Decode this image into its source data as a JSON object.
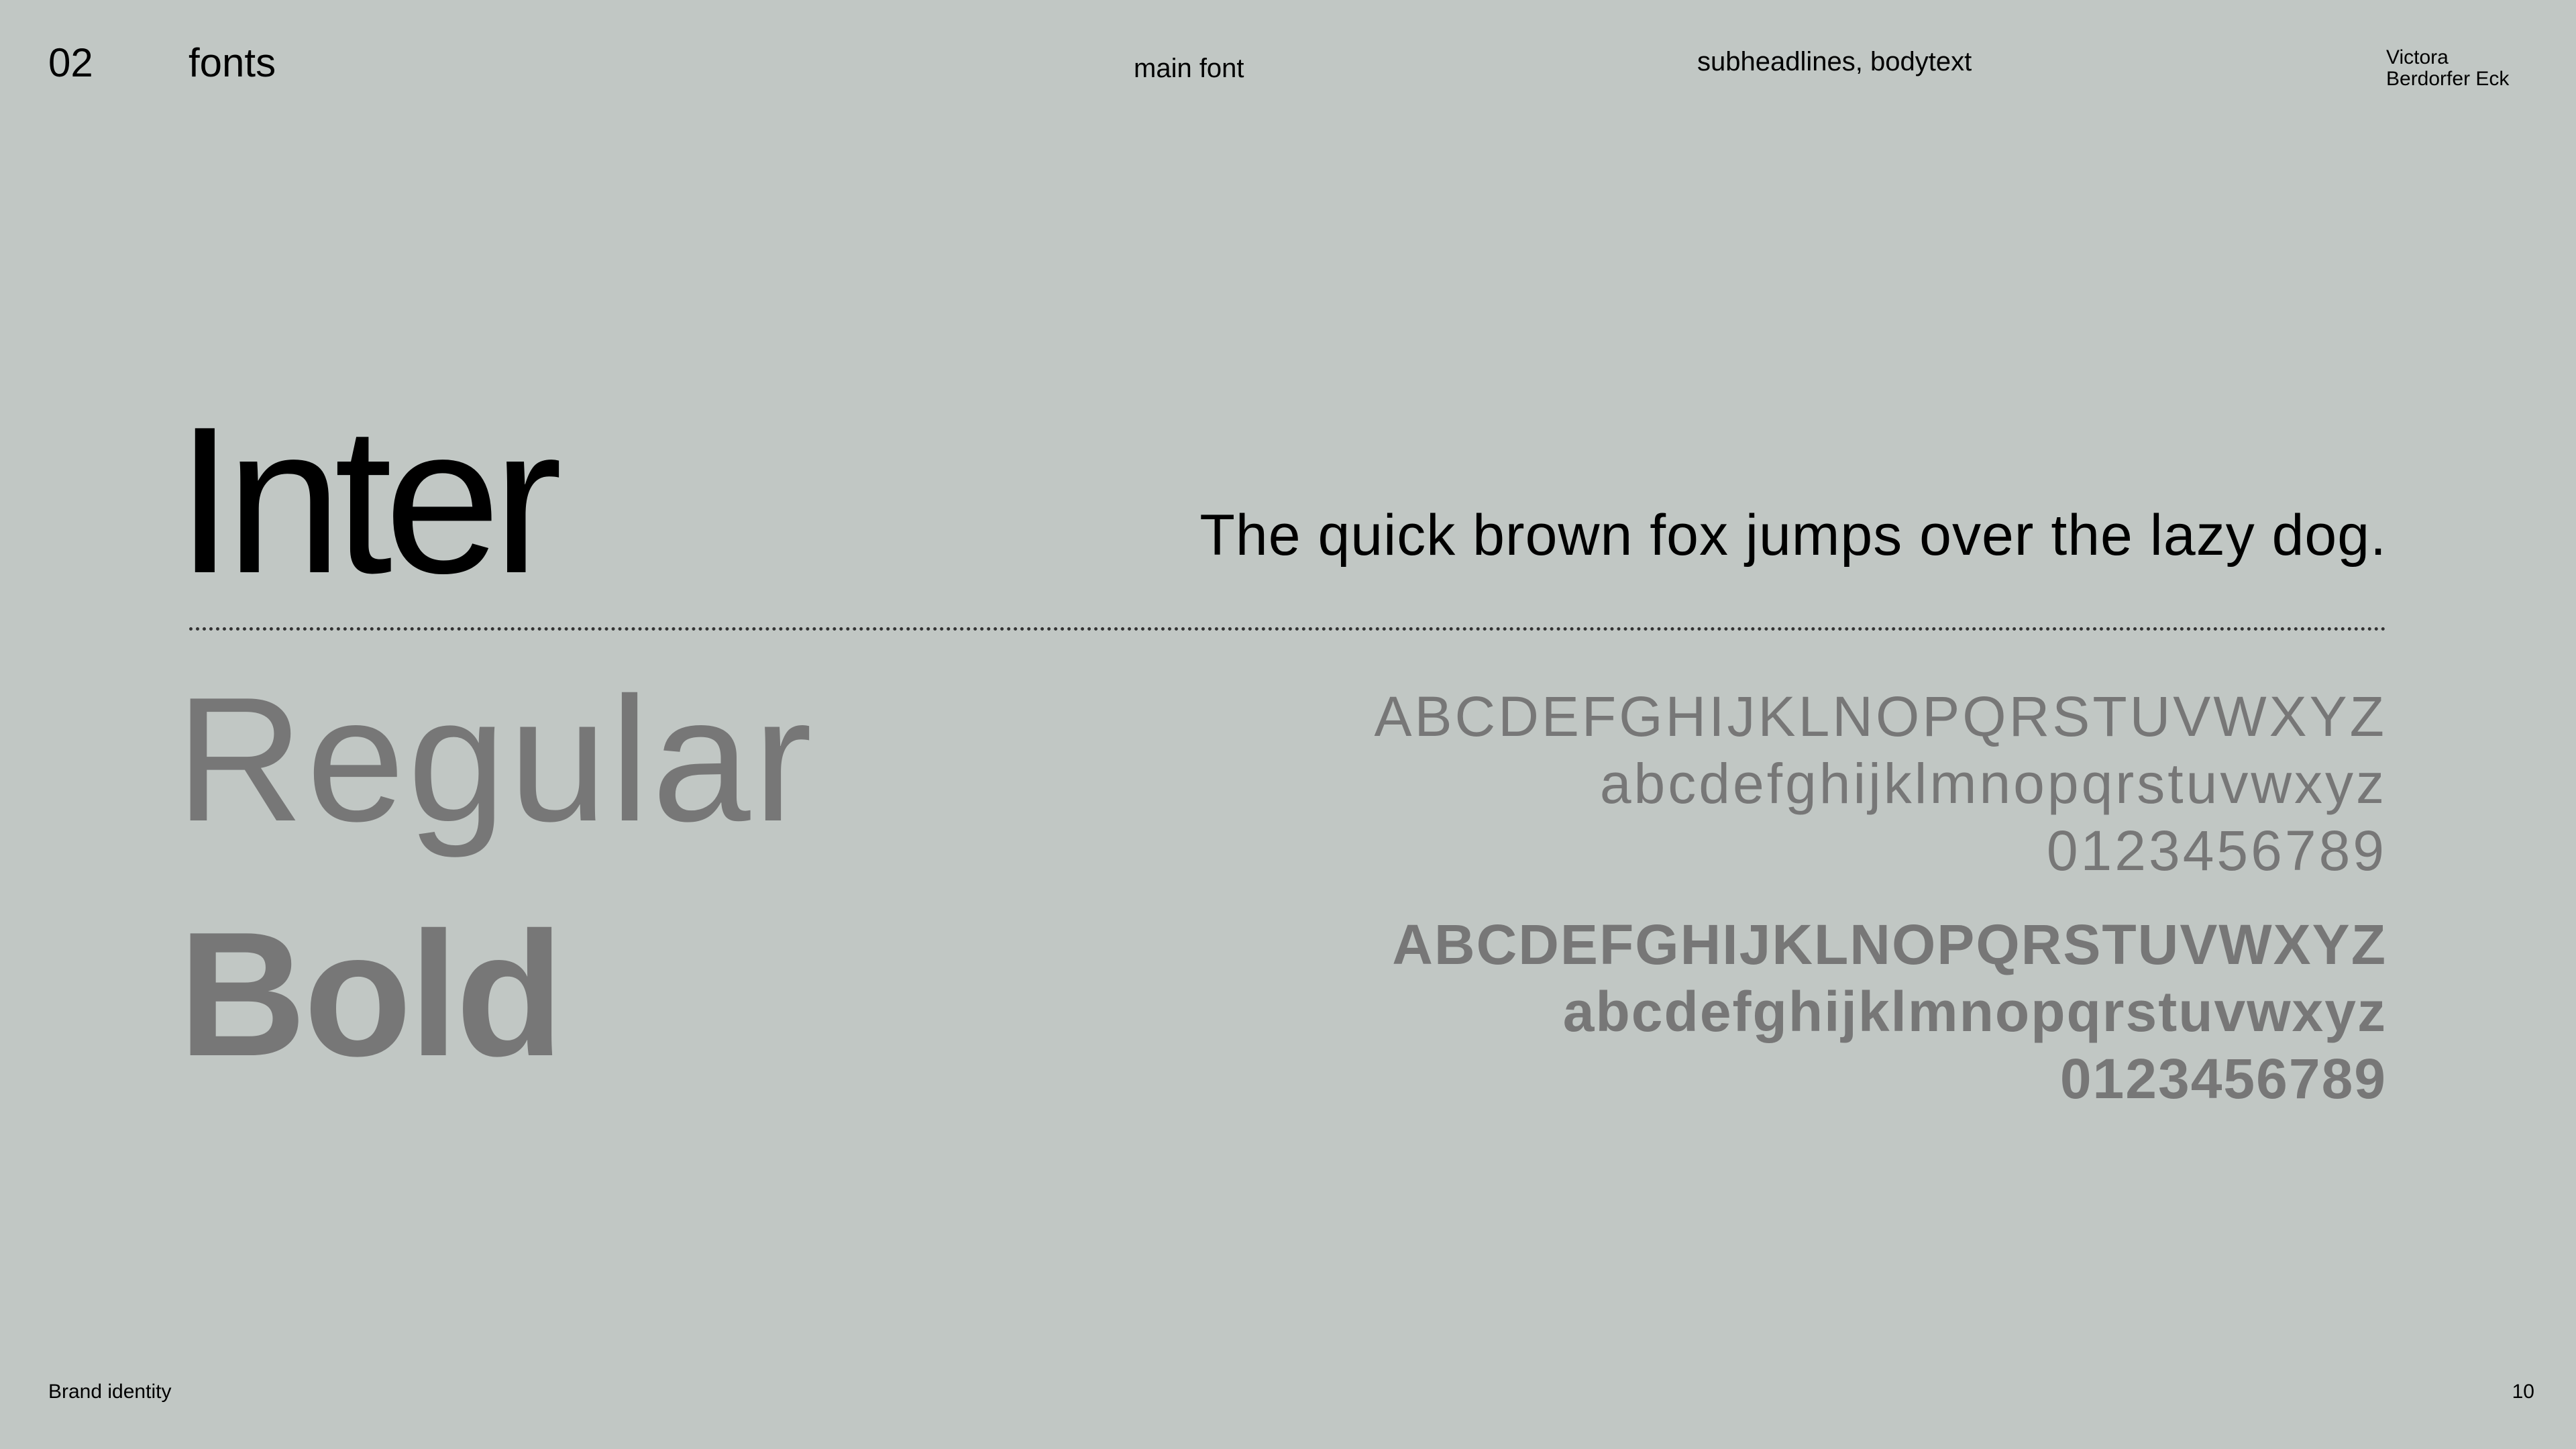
{
  "header": {
    "section_number": "02",
    "section_title": "fonts",
    "main_font_label": "main font",
    "secondary_label": "subheadlines, bodytext",
    "author_line1": "Victora",
    "author_line2": "Berdorfer Eck"
  },
  "specimen": {
    "font_name": "Inter",
    "pangram": "The quick brown fox jumps over the lazy dog.",
    "weights": {
      "regular": "Regular",
      "bold": "Bold"
    },
    "regular_glyphs": {
      "uppercase": "ABCDEFGHIJKLNOPQRSTUVWXYZ",
      "lowercase": "abcdefghijklmnopqrstuvwxyz",
      "digits": "0123456789"
    },
    "bold_glyphs": {
      "uppercase": "ABCDEFGHIJKLNOPQRSTUVWXYZ",
      "lowercase": "abcdefghijklmnopqrstuvwxyz",
      "digits": "0123456789"
    }
  },
  "footer": {
    "label": "Brand identity",
    "page_number": "10"
  },
  "colors": {
    "background": "#c1c7c4",
    "primary_text": "#000000",
    "secondary_text": "#777777"
  }
}
